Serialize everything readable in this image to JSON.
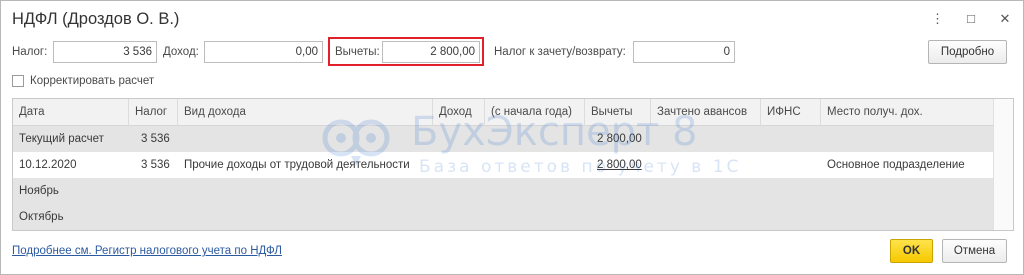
{
  "window": {
    "title": "НДФЛ (Дроздов О. В.)"
  },
  "header": {
    "nalog_label": "Налог:",
    "nalog_value": "3 536",
    "dohod_label": "Доход:",
    "dohod_value": "0,00",
    "vychety_label": "Вычеты:",
    "vychety_value": "2 800,00",
    "zachet_label": "Налог к зачету/возврату:",
    "zachet_value": "0",
    "details_button": "Подробно"
  },
  "options": {
    "correct_label": "Корректировать расчет",
    "correct_checked": false
  },
  "table": {
    "columns": [
      "Дата",
      "Налог",
      "Вид дохода",
      "Доход",
      "(с начала года)",
      "Вычеты",
      "Зачтено авансов",
      "ИФНС",
      "Место получ. дох."
    ],
    "rows": [
      {
        "date": "Текущий расчет",
        "tax": "3 536",
        "kind": "",
        "income": "",
        "ytd": "",
        "deductions": "2 800,00",
        "advances": "",
        "ifns": "",
        "place": "",
        "group": true
      },
      {
        "date": "10.12.2020",
        "tax": "3 536",
        "kind": "Прочие доходы от трудовой деятельности",
        "income": "",
        "ytd": "",
        "deductions": "2 800,00",
        "advances": "",
        "ifns": "",
        "place": "Основное подразделение",
        "group": false
      },
      {
        "date": "Ноябрь",
        "tax": "",
        "kind": "",
        "income": "",
        "ytd": "",
        "deductions": "",
        "advances": "",
        "ifns": "",
        "place": "",
        "group": true
      },
      {
        "date": "Октябрь",
        "tax": "",
        "kind": "",
        "income": "",
        "ytd": "",
        "deductions": "",
        "advances": "",
        "ifns": "",
        "place": "",
        "group": true
      }
    ]
  },
  "watermark": {
    "title": "БухЭксперт 8",
    "subtitle": "База ответов по учету в 1С"
  },
  "footer": {
    "link": "Подробнее см. Регистр налогового учета по НДФЛ",
    "ok_button": "OK",
    "cancel_button": "Отмена"
  },
  "colors": {
    "highlight": "#e0202a",
    "ok_button": "#f5c800",
    "link": "#2c5aa0"
  }
}
